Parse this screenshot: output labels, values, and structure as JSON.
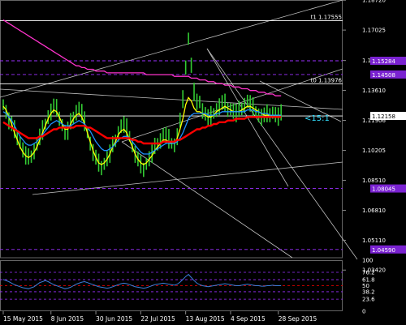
{
  "chart_data": [
    {
      "type": "line",
      "title": "",
      "ylim": [
        1.0412,
        1.1873
      ],
      "y_ticks": [
        "1.18720",
        "1.17025",
        "1.15300",
        "1.13610",
        "1.11906",
        "1.10205",
        "1.08510",
        "1.06810",
        "1.05110",
        "1.03420"
      ],
      "y_ticks_at": [
        1.1872,
        1.17025,
        1.153,
        1.1361,
        1.11906,
        1.10205,
        1.0851,
        1.0681,
        1.0511,
        1.0342
      ],
      "x_ticks": [
        "15 May 2015",
        "8 Jun 2015",
        "30 Jun 2015",
        "22 Jul 2015",
        "13 Aug 2015",
        "4 Sep 2015",
        "28 Sep 2015"
      ],
      "x_ticks_at": [
        0,
        17,
        33,
        49,
        65,
        81,
        98
      ],
      "x_count": 104,
      "levels": [
        {
          "label": "t1 1.17555",
          "value": 1.17555,
          "color": "#ffffff",
          "style": "solid"
        },
        {
          "label": "1.15284",
          "value": 1.15284,
          "color": "#9b30ff",
          "style": "dashed"
        },
        {
          "label": "1.14508",
          "value": 1.14508,
          "color": "#9b30ff",
          "style": "dashed"
        },
        {
          "label": "t0 1.13976",
          "value": 1.13976,
          "color": "#ffffff",
          "style": "solid"
        },
        {
          "label": "1.12158",
          "value": 1.12158,
          "color": "#ffffff",
          "style": "solid"
        },
        {
          "label": "1.08045",
          "value": 1.08045,
          "color": "#9b30ff",
          "style": "dashed"
        },
        {
          "label": "1.04590",
          "value": 1.0459,
          "color": "#9b30ff",
          "style": "dashed"
        }
      ],
      "current_price": 1.12158,
      "annotation": "<15:1",
      "series": [
        {
          "kind": "price",
          "color": "#33cc33",
          "values": [
            1.128,
            1.124,
            1.119,
            1.116,
            1.113,
            1.11,
            1.106,
            1.102,
            1.099,
            1.097,
            1.099,
            1.102,
            1.105,
            1.109,
            1.113,
            1.117,
            1.121,
            1.124,
            1.126,
            1.125,
            1.121,
            1.116,
            1.112,
            1.113,
            1.117,
            1.121,
            1.124,
            1.125,
            1.123,
            1.118,
            1.112,
            1.106,
            1.101,
            1.097,
            1.094,
            1.093,
            1.094,
            1.097,
            1.1,
            1.104,
            1.108,
            1.112,
            1.115,
            1.116,
            1.114,
            1.11,
            1.105,
            1.1,
            1.096,
            1.093,
            1.092,
            1.094,
            1.097,
            1.1,
            1.103,
            1.106,
            1.108,
            1.11,
            1.11,
            1.108,
            1.106,
            1.105,
            1.11,
            1.118,
            1.13,
            1.15,
            1.165,
            1.15,
            1.135,
            1.128,
            1.13,
            1.125,
            1.122,
            1.12,
            1.121,
            1.123,
            1.125,
            1.127,
            1.128,
            1.128,
            1.126,
            1.125,
            1.124,
            1.123,
            1.124,
            1.126,
            1.128,
            1.129,
            1.128,
            1.126,
            1.124,
            1.122,
            1.121,
            1.121,
            1.122,
            1.123,
            1.123,
            1.122,
            1.121,
            1.122
          ]
        },
        {
          "kind": "ma",
          "color": "#ffff00",
          "values": [
            1.127,
            1.125,
            1.121,
            1.117,
            1.112,
            1.108,
            1.104,
            1.101,
            1.099,
            1.098,
            1.099,
            1.101,
            1.104,
            1.108,
            1.112,
            1.116,
            1.12,
            1.123,
            1.125,
            1.124,
            1.121,
            1.117,
            1.114,
            1.114,
            1.117,
            1.12,
            1.122,
            1.123,
            1.121,
            1.117,
            1.112,
            1.107,
            1.102,
            1.098,
            1.095,
            1.094,
            1.095,
            1.097,
            1.1,
            1.104,
            1.107,
            1.111,
            1.113,
            1.114,
            1.112,
            1.108,
            1.104,
            1.1,
            1.097,
            1.095,
            1.094,
            1.095,
            1.097,
            1.099,
            1.102,
            1.104,
            1.106,
            1.108,
            1.108,
            1.107,
            1.106,
            1.106,
            1.109,
            1.114,
            1.12,
            1.128,
            1.132,
            1.13,
            1.126,
            1.124,
            1.124,
            1.123,
            1.122,
            1.121,
            1.121,
            1.122,
            1.124,
            1.125,
            1.126,
            1.127,
            1.126,
            1.125,
            1.124,
            1.124,
            1.124,
            1.125,
            1.126,
            1.127,
            1.127,
            1.126,
            1.125,
            1.124,
            1.123,
            1.122,
            1.122,
            1.122,
            1.122,
            1.122,
            1.122,
            1.122
          ]
        },
        {
          "kind": "ma",
          "color": "#1e90ff",
          "values": [
            1.124,
            1.123,
            1.121,
            1.119,
            1.116,
            1.113,
            1.11,
            1.108,
            1.106,
            1.105,
            1.105,
            1.106,
            1.107,
            1.109,
            1.111,
            1.113,
            1.115,
            1.117,
            1.118,
            1.119,
            1.118,
            1.117,
            1.116,
            1.116,
            1.116,
            1.117,
            1.118,
            1.119,
            1.118,
            1.117,
            1.115,
            1.113,
            1.11,
            1.107,
            1.105,
            1.103,
            1.102,
            1.102,
            1.103,
            1.104,
            1.106,
            1.108,
            1.109,
            1.11,
            1.11,
            1.109,
            1.107,
            1.105,
            1.103,
            1.101,
            1.1,
            1.1,
            1.1,
            1.101,
            1.102,
            1.103,
            1.104,
            1.105,
            1.106,
            1.106,
            1.106,
            1.106,
            1.107,
            1.109,
            1.112,
            1.116,
            1.12,
            1.122,
            1.123,
            1.123,
            1.123,
            1.123,
            1.123,
            1.122,
            1.122,
            1.122,
            1.123,
            1.123,
            1.124,
            1.124,
            1.124,
            1.124,
            1.124,
            1.124,
            1.124,
            1.124,
            1.124,
            1.125,
            1.125,
            1.125,
            1.124,
            1.124,
            1.123,
            1.123,
            1.123,
            1.122,
            1.122,
            1.122,
            1.122,
            1.122
          ]
        },
        {
          "kind": "ma",
          "color": "#ff0000",
          "values": [
            1.118,
            1.117,
            1.116,
            1.115,
            1.114,
            1.113,
            1.112,
            1.111,
            1.11,
            1.109,
            1.109,
            1.109,
            1.109,
            1.11,
            1.11,
            1.111,
            1.112,
            1.113,
            1.114,
            1.114,
            1.115,
            1.115,
            1.115,
            1.115,
            1.115,
            1.115,
            1.116,
            1.116,
            1.116,
            1.116,
            1.115,
            1.115,
            1.114,
            1.113,
            1.112,
            1.111,
            1.11,
            1.109,
            1.109,
            1.109,
            1.109,
            1.109,
            1.109,
            1.109,
            1.109,
            1.109,
            1.108,
            1.108,
            1.107,
            1.107,
            1.106,
            1.106,
            1.106,
            1.106,
            1.106,
            1.106,
            1.106,
            1.107,
            1.107,
            1.107,
            1.107,
            1.107,
            1.108,
            1.108,
            1.109,
            1.11,
            1.111,
            1.112,
            1.113,
            1.114,
            1.114,
            1.115,
            1.115,
            1.116,
            1.116,
            1.117,
            1.117,
            1.118,
            1.118,
            1.118,
            1.119,
            1.119,
            1.119,
            1.12,
            1.12,
            1.12,
            1.12,
            1.121,
            1.121,
            1.121,
            1.121,
            1.121,
            1.121,
            1.121,
            1.121,
            1.121,
            1.121,
            1.121,
            1.121,
            1.121
          ]
        },
        {
          "kind": "ma",
          "color": "#ff33cc",
          "values": [
            1.176,
            1.175,
            1.174,
            1.173,
            1.172,
            1.171,
            1.17,
            1.169,
            1.168,
            1.167,
            1.166,
            1.165,
            1.164,
            1.163,
            1.162,
            1.161,
            1.16,
            1.159,
            1.158,
            1.157,
            1.156,
            1.155,
            1.154,
            1.153,
            1.152,
            1.151,
            1.15,
            1.15,
            1.149,
            1.149,
            1.148,
            1.148,
            1.148,
            1.147,
            1.147,
            1.147,
            1.147,
            1.146,
            1.146,
            1.146,
            1.146,
            1.146,
            1.146,
            1.146,
            1.146,
            1.146,
            1.146,
            1.146,
            1.146,
            1.146,
            1.146,
            1.145,
            1.145,
            1.145,
            1.145,
            1.145,
            1.145,
            1.145,
            1.145,
            1.145,
            1.145,
            1.144,
            1.144,
            1.144,
            1.144,
            1.144,
            1.144,
            1.143,
            1.143,
            1.143,
            1.142,
            1.142,
            1.142,
            1.141,
            1.141,
            1.141,
            1.14,
            1.14,
            1.14,
            1.139,
            1.139,
            1.139,
            1.138,
            1.138,
            1.138,
            1.137,
            1.137,
            1.137,
            1.136,
            1.136,
            1.136,
            1.135,
            1.135,
            1.135,
            1.134,
            1.134,
            1.134,
            1.133,
            1.133,
            1.133
          ]
        }
      ]
    },
    {
      "type": "line",
      "title": "",
      "ylim": [
        0,
        100
      ],
      "y_ticks": [
        "100",
        "76.2",
        "61.8",
        "50",
        "38.2",
        "23.6",
        "0"
      ],
      "y_ticks_at": [
        100,
        76.2,
        61.8,
        50,
        38.2,
        23.6,
        0
      ],
      "levels": [
        {
          "value": 76.2,
          "color": "#9b30ff"
        },
        {
          "value": 61.8,
          "color": "#9b30ff"
        },
        {
          "value": 50,
          "color": "#ff0000"
        },
        {
          "value": 38.2,
          "color": "#9b30ff"
        },
        {
          "value": 23.6,
          "color": "#9b30ff"
        }
      ],
      "series": [
        {
          "kind": "oscillator",
          "color": "#3b7dd8",
          "values": [
            62,
            60,
            58,
            55,
            52,
            50,
            48,
            46,
            45,
            44,
            46,
            48,
            52,
            56,
            58,
            60,
            58,
            55,
            52,
            50,
            48,
            46,
            44,
            45,
            47,
            50,
            53,
            55,
            57,
            58,
            56,
            54,
            52,
            50,
            48,
            47,
            46,
            45,
            46,
            48,
            50,
            52,
            54,
            55,
            54,
            52,
            50,
            48,
            47,
            46,
            45,
            46,
            48,
            50,
            52,
            53,
            54,
            55,
            54,
            53,
            52,
            51,
            53,
            57,
            62,
            68,
            72,
            66,
            60,
            55,
            52,
            50,
            49,
            48,
            49,
            50,
            51,
            52,
            53,
            54,
            53,
            52,
            51,
            50,
            50,
            51,
            52,
            53,
            52,
            51,
            50,
            50,
            49,
            49,
            50,
            50,
            51,
            50,
            50,
            50
          ]
        }
      ]
    }
  ]
}
